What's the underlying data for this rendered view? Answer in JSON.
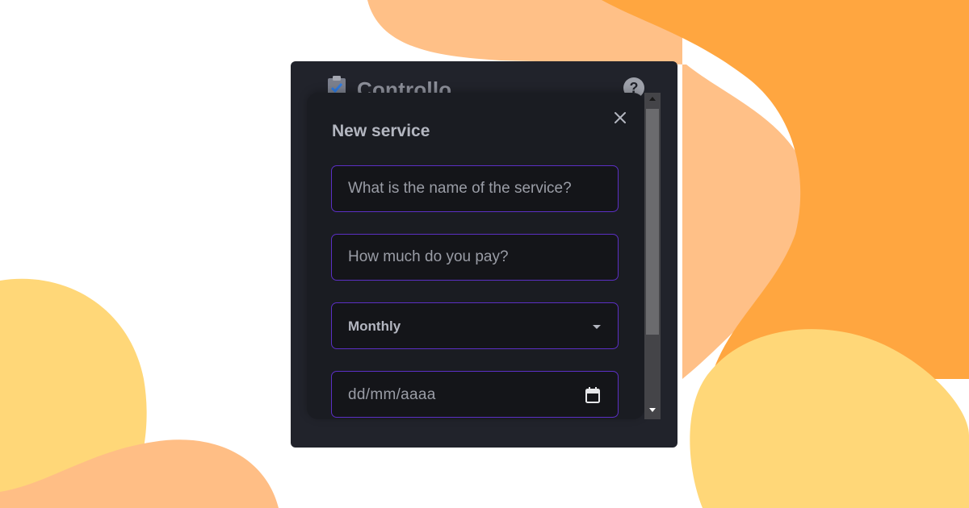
{
  "app": {
    "title": "Controllo",
    "logo_icon": "clipboard-check-icon",
    "help_icon": "question-circle-icon",
    "help_label": "?"
  },
  "modal": {
    "title": "New service",
    "close_icon": "close-icon",
    "name_placeholder": "What is the name of the service?",
    "price_placeholder": "How much do you pay?",
    "frequency_value": "Monthly",
    "date_placeholder": "dd/mm/aaaa",
    "calendar_icon": "calendar-icon",
    "dropdown_icon": "chevron-down-icon"
  },
  "colors": {
    "app_bg": "#21232b",
    "modal_bg": "#1a1c22",
    "field_border": "#5b2fc4",
    "blob_orange": "#ffa640",
    "blob_light_orange": "#ffc087",
    "blob_yellow": "#ffd778"
  }
}
